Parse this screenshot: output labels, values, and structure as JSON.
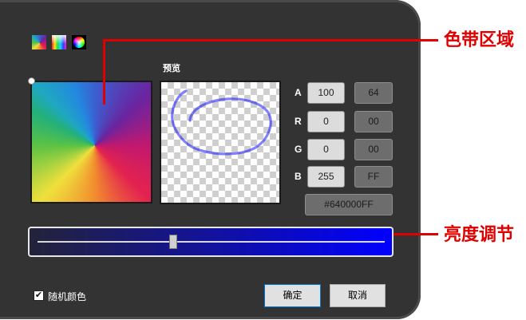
{
  "mode_icons": [
    "conic-gradient-icon",
    "hue-saturation-icon",
    "color-wheel-icon"
  ],
  "preview": {
    "label": "预览"
  },
  "channels": [
    {
      "label": "A",
      "decimal": "100",
      "hex": "64"
    },
    {
      "label": "R",
      "decimal": "0",
      "hex": "00"
    },
    {
      "label": "G",
      "decimal": "0",
      "hex": "00"
    },
    {
      "label": "B",
      "decimal": "255",
      "hex": "FF"
    }
  ],
  "color_code": "#640000FF",
  "brightness": {
    "level": 0.39
  },
  "random_color": {
    "label": "随机颜色",
    "checked": true
  },
  "buttons": {
    "ok": "确定",
    "cancel": "取消"
  },
  "annotations": {
    "color_band": "色带区域",
    "brightness": "亮度调节"
  },
  "colors": {
    "panel": "#333333",
    "annotation": "#e00000",
    "selected": "#0000ff",
    "default_button_border": "#0078d7"
  }
}
